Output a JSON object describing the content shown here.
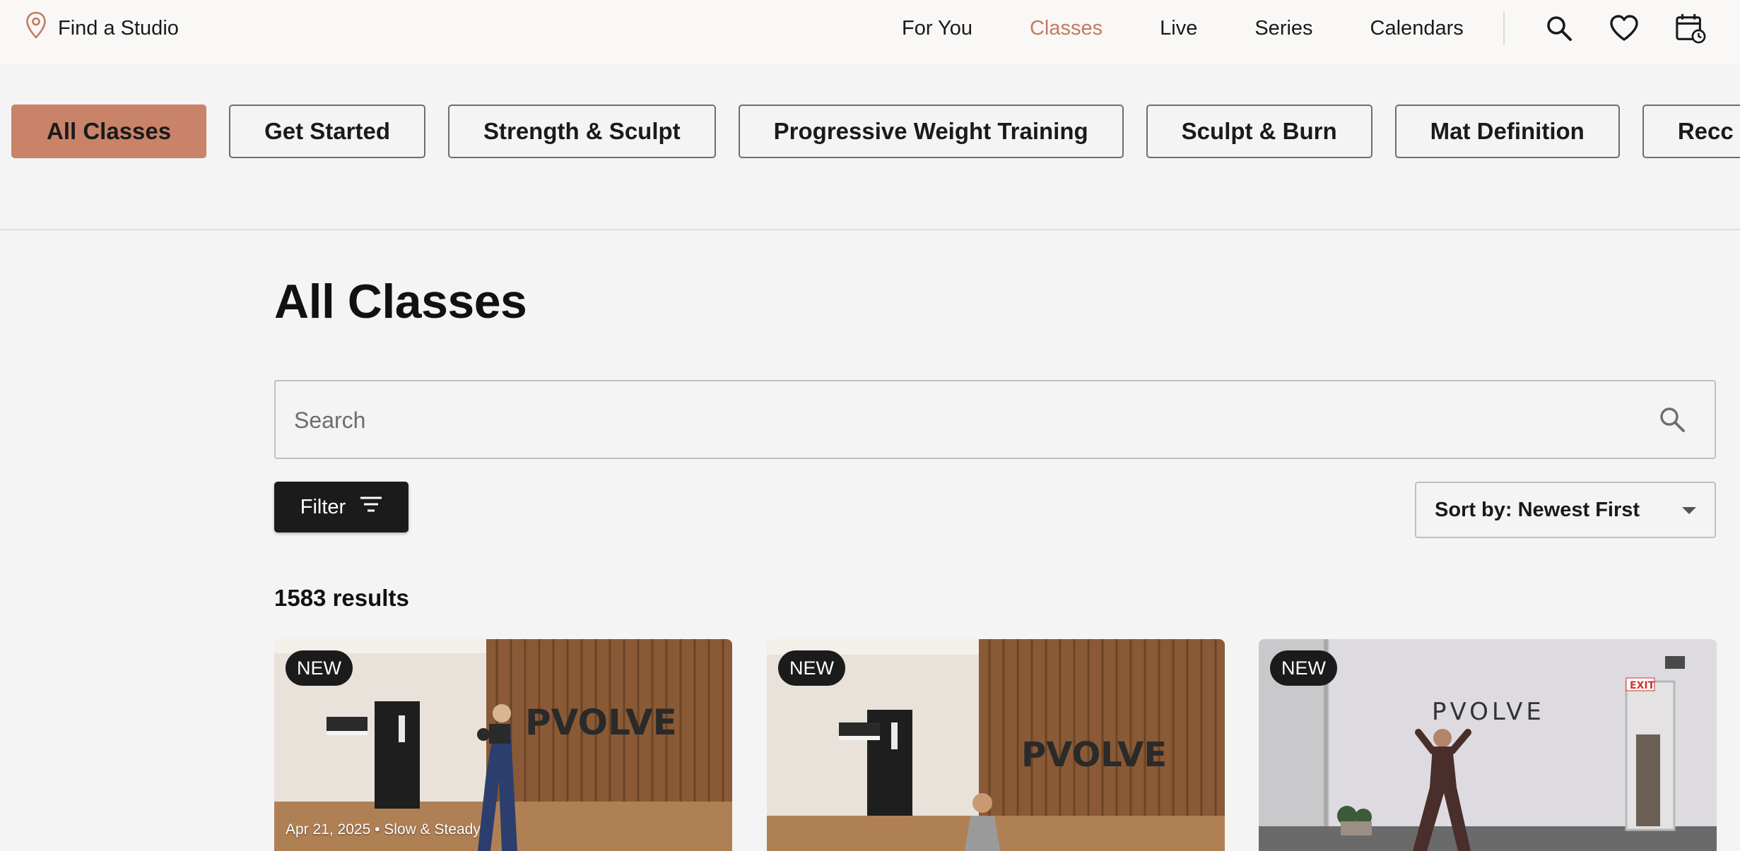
{
  "header": {
    "find_studio": "Find a Studio",
    "nav": [
      {
        "label": "For You",
        "active": false
      },
      {
        "label": "Classes",
        "active": true
      },
      {
        "label": "Live",
        "active": false
      },
      {
        "label": "Series",
        "active": false
      },
      {
        "label": "Calendars",
        "active": false
      }
    ],
    "icons": [
      "search-icon",
      "heart-icon",
      "calendar-history-icon"
    ],
    "accent_color": "#c27b5f"
  },
  "categories": [
    {
      "label": "All Classes",
      "active": true
    },
    {
      "label": "Get Started",
      "active": false
    },
    {
      "label": "Strength & Sculpt",
      "active": false
    },
    {
      "label": "Progressive Weight Training",
      "active": false
    },
    {
      "label": "Sculpt & Burn",
      "active": false
    },
    {
      "label": "Mat Definition",
      "active": false
    },
    {
      "label": "Recc",
      "active": false
    }
  ],
  "main": {
    "title": "All Classes",
    "search_placeholder": "Search",
    "filter_label": "Filter",
    "sort_label": "Sort by: Newest First",
    "results": "1583 results"
  },
  "cards": [
    {
      "badge": "NEW",
      "meta": "Apr 21, 2025 • Slow & Steady",
      "brand": "PVOLVE"
    },
    {
      "badge": "NEW",
      "meta": "",
      "brand": "PVOLVE"
    },
    {
      "badge": "NEW",
      "meta": "",
      "brand": "PVOLVE",
      "exit_sign": "EXIT"
    }
  ]
}
